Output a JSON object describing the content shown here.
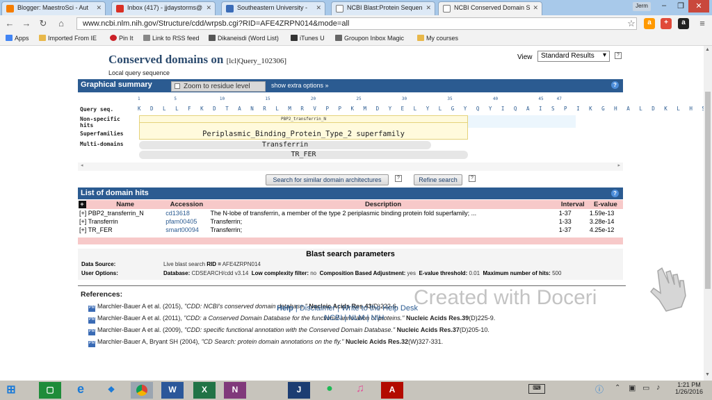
{
  "browser": {
    "tabs": [
      {
        "label": "Blogger: MaestroSci - Aut",
        "color": "#f57d00"
      },
      {
        "label": "Inbox (417) - jjdaystorms@",
        "color": "#d93025"
      },
      {
        "label": "Southeastern University -",
        "color": "#3b6cb7"
      },
      {
        "label": "NCBI Blast:Protein Sequen",
        "color": "#777777"
      },
      {
        "label": "NCBI Conserved Domain S",
        "color": "#777777"
      }
    ],
    "user": "Jerm",
    "url": "www.ncbi.nlm.nih.gov/Structure/cdd/wrpsb.cgi?RID=AFE4ZRPN014&mode=all",
    "bookmarks": [
      {
        "label": "Apps",
        "color": "#4285f4"
      },
      {
        "label": "Imported From IE",
        "color": "#e8b84a"
      },
      {
        "label": "Pin It",
        "color": "#cb2027"
      },
      {
        "label": "Link to RSS feed",
        "color": "#888888"
      },
      {
        "label": "Dikaneisdi (Word List)",
        "color": "#555555"
      },
      {
        "label": "iTunes U",
        "color": "#333333"
      },
      {
        "label": "Groupon Inbox Magic",
        "color": "#666666"
      },
      {
        "label": "My courses",
        "color": "#e8b84a"
      }
    ]
  },
  "page": {
    "title": "Conserved domains on",
    "query_id": "[lcl|Query_102306]",
    "subtitle": "Local query sequence",
    "view_label": "View",
    "view_value": "Standard Results",
    "help": "?",
    "graphical_summary": "Graphical summary",
    "zoom_label": "Zoom to residue level",
    "extra_options": "show extra options »",
    "ruler": [
      "1",
      "5",
      "10",
      "15",
      "20",
      "25",
      "30",
      "35",
      "40",
      "45",
      "47"
    ],
    "row_labels": {
      "query": "Query seq.",
      "nonspecific": "Non-specific",
      "hits": "hits",
      "superfamilies": "Superfamilies",
      "multidomains": "Multi-domains"
    },
    "sequence": "K D L L F K D T A N R L M R V P P K M D Y E L Y L G Y Q Y I Q A I S P I K G H A L D K L H S L",
    "nonspecific_hit": "PBP2_transferrin_N",
    "superfamily": "Periplasmic_Binding_Protein_Type_2 superfamily",
    "multidomain_1": "Transferrin",
    "multidomain_2": "TR_FER",
    "search_similar": "Search for similar domain architectures",
    "refine_search": "Refine search",
    "list_title": "List of domain hits",
    "table": {
      "headers": [
        "Name",
        "Accession",
        "Description",
        "Interval",
        "E-value"
      ],
      "rows": [
        {
          "name": "[+] PBP2_transferrin_N",
          "accession": "cd13618",
          "description": "The N-lobe of transferrin, a member of the type 2 periplasmic binding protein fold superfamily; ...",
          "interval": "1-37",
          "evalue": "1.59e-13"
        },
        {
          "name": "[+] Transferrin",
          "accession": "pfam00405",
          "description": "Transferrin;",
          "interval": "1-33",
          "evalue": "3.28e-14"
        },
        {
          "name": "[+] TR_FER",
          "accession": "smart00094",
          "description": "Transferrin;",
          "interval": "1-37",
          "evalue": "4.25e-12"
        }
      ]
    },
    "blast": {
      "title": "Blast search parameters",
      "data_source_label": "Data Source:",
      "data_source_value": "Live blast search",
      "rid_label": "RID =",
      "rid_value": "AFE4ZRPN014",
      "user_options_label": "User Options:",
      "database_label": "Database:",
      "database_value": "CDSEARCH/cdd v3.14",
      "low_complexity_label": "Low complexity filter:",
      "low_complexity_value": "no",
      "composition_label": "Composition Based Adjustment:",
      "composition_value": "yes",
      "evalue_label": "E-value threshold:",
      "evalue_value": "0.01",
      "max_hits_label": "Maximum number of hits:",
      "max_hits_value": "500"
    },
    "references_title": "References:",
    "references": [
      {
        "authors": "Marchler-Bauer A et al. (2015),",
        "title": "\"CDD: NCBI's conserved domain database.\"",
        "journal": "Nucleic Acids Res.43",
        "pages": "(D)222-6."
      },
      {
        "authors": "Marchler-Bauer A et al. (2011),",
        "title": "\"CDD: a Conserved Domain Database for the functional annotation of proteins.\"",
        "journal": "Nucleic Acids Res.39",
        "pages": "(D)225-9."
      },
      {
        "authors": "Marchler-Bauer A et al. (2009),",
        "title": "\"CDD: specific functional annotation with the Conserved Domain Database.\"",
        "journal": "Nucleic Acids Res.37",
        "pages": "(D)205-10."
      },
      {
        "authors": "Marchler-Bauer A, Bryant SH (2004),",
        "title": "\"CD Search: protein domain annotations on the fly.\"",
        "journal": "Nucleic Acids Res.32",
        "pages": "(W)327-331."
      }
    ],
    "footer": {
      "help": "Help",
      "disclaimer": "Disclaimer",
      "write": "Write to the Help Desk",
      "ncbi": "NCBI",
      "nlm": "NLM",
      "nih": "NIH"
    },
    "watermark": "Created with Doceri"
  },
  "taskbar": {
    "time": "1:21 PM",
    "date": "1/26/2016"
  }
}
